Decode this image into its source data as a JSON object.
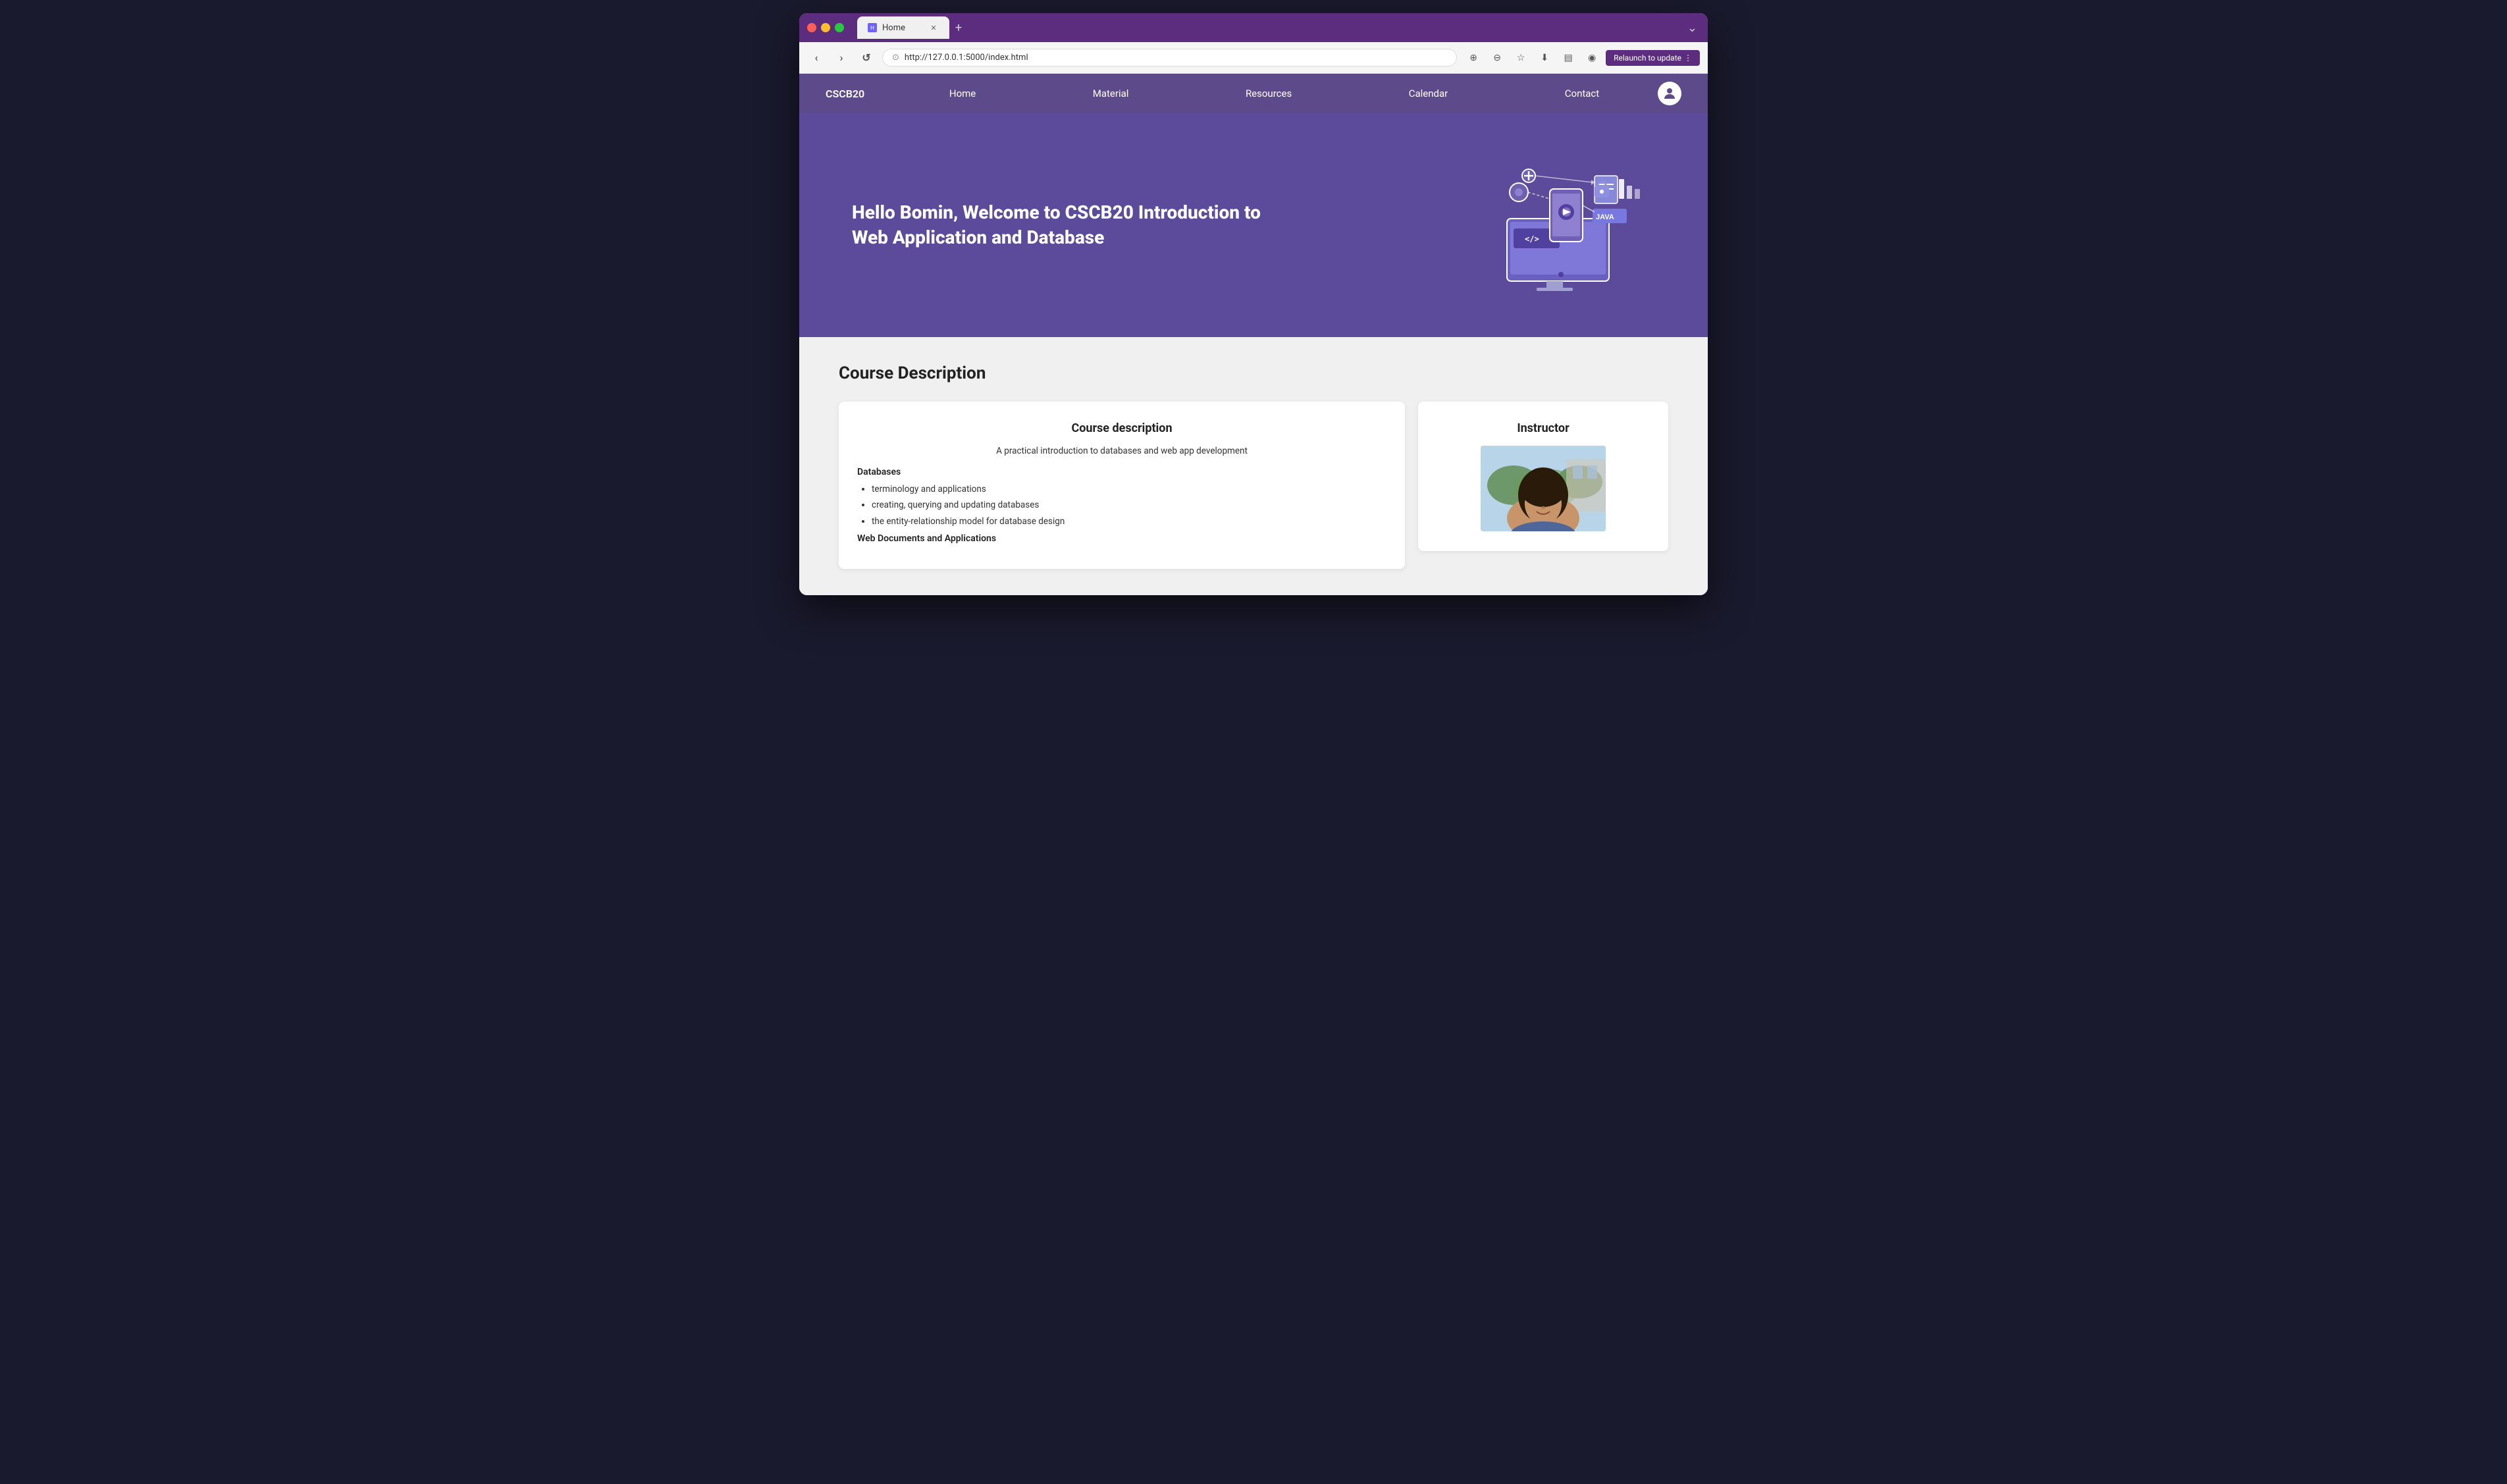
{
  "browser": {
    "tab_title": "Home",
    "tab_favicon": "H",
    "url": "http://127.0.0.1:5000/index.html",
    "relaunch_label": "Relaunch to update",
    "new_tab_symbol": "+",
    "dropdown_symbol": "⌄",
    "nav": {
      "back": "‹",
      "forward": "›",
      "reload": "↺"
    }
  },
  "site": {
    "logo": "CSCB20",
    "nav_links": [
      "Home",
      "Material",
      "Resources",
      "Calendar",
      "Contact"
    ],
    "hero": {
      "greeting": "Hello Bomin, Welcome to CSCB20 Introduction to Web Application and Database"
    },
    "course_description_heading": "Course Description",
    "course_card": {
      "title": "Course description",
      "subtitle": "A practical introduction to databases and web app development",
      "section1": "Databases",
      "items1": [
        "terminology and applications",
        "creating, querying and updating databases",
        "the entity-relationship model for database design"
      ],
      "section2": "Web Documents and Applications"
    },
    "instructor_card": {
      "title": "Instructor"
    }
  }
}
